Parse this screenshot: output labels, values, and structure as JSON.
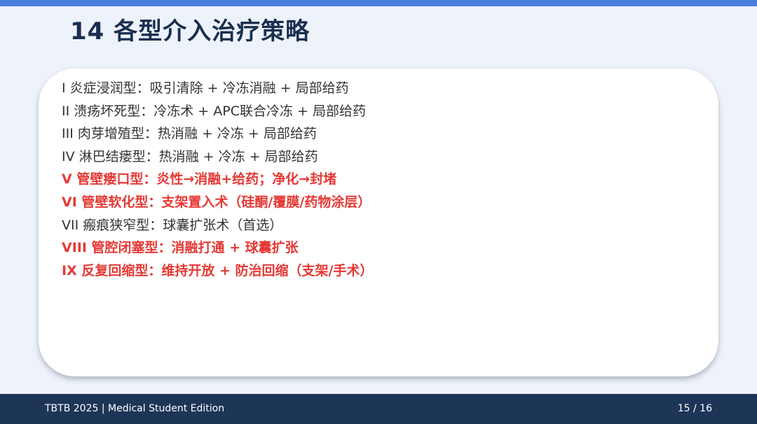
{
  "slide": {
    "title": "14 各型介入治疗策略"
  },
  "strategies": [
    {
      "text": "I 炎症浸润型：吸引清除 + 冷冻消融 + 局部给药",
      "highlight": false
    },
    {
      "text": "II 溃疡坏死型：冷冻术 + APC联合冷冻 + 局部给药",
      "highlight": false
    },
    {
      "text": "III 肉芽增殖型：热消融 + 冷冻 + 局部给药",
      "highlight": false
    },
    {
      "text": "IV 淋巴结瘘型：热消融 + 冷冻 + 局部给药",
      "highlight": false
    },
    {
      "text": "V 管壁瘘口型：炎性→消融+给药；净化→封堵",
      "highlight": true
    },
    {
      "text": "VI 管壁软化型：支架置入术（硅酮/覆膜/药物涂层）",
      "highlight": true
    },
    {
      "text": "VII 瘢痕狭窄型：球囊扩张术（首选）",
      "highlight": false
    },
    {
      "text": "VIII 管腔闭塞型：消融打通 + 球囊扩张",
      "highlight": true
    },
    {
      "text": "IX 反复回缩型：维持开放 + 防治回缩（支架/手术）",
      "highlight": true
    }
  ],
  "footer": {
    "left": "TBTB 2025 | Medical Student Edition",
    "page": "15 / 16"
  },
  "colors": {
    "accent_bar": "#4a7fe0",
    "title": "#1a2f4f",
    "highlight": "#e53935",
    "footer_bg": "#1d3557"
  }
}
